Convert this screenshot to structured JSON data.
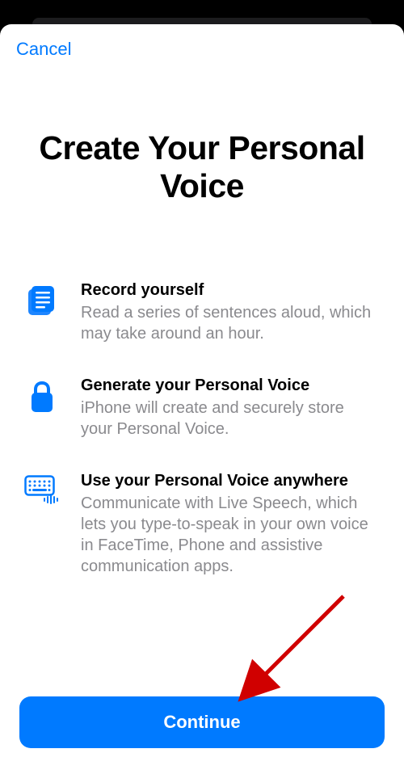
{
  "header": {
    "cancel_label": "Cancel"
  },
  "title": "Create Your Personal Voice",
  "features": [
    {
      "title": "Record yourself",
      "description": "Read a series of sentences aloud, which may take around an hour."
    },
    {
      "title": "Generate your Personal Voice",
      "description": "iPhone will create and securely store your Personal Voice."
    },
    {
      "title": "Use your Personal Voice anywhere",
      "description": "Communicate with Live Speech, which lets you type-to-speak in your own voice in FaceTime, Phone and assistive communication apps."
    }
  ],
  "footer": {
    "continue_label": "Continue"
  },
  "colors": {
    "accent": "#007aff",
    "secondary_text": "#8a8a8e"
  }
}
